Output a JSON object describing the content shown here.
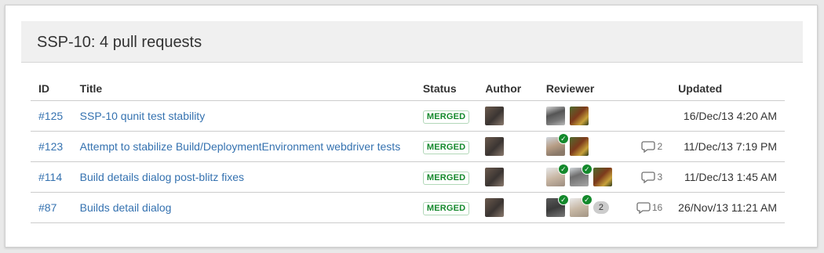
{
  "dialog": {
    "title": "SSP-10: 4 pull requests"
  },
  "table": {
    "headers": {
      "id": "ID",
      "title": "Title",
      "status": "Status",
      "author": "Author",
      "reviewer": "Reviewer",
      "updated": "Updated"
    },
    "rows": [
      {
        "id": "#125",
        "title": "SSP-10 qunit test stability",
        "status": "MERGED",
        "comments": "",
        "updated": "16/Dec/13 4:20 AM"
      },
      {
        "id": "#123",
        "title": "Attempt to stabilize Build/DeploymentEnvironment webdriver tests",
        "status": "MERGED",
        "comments": "2",
        "updated": "11/Dec/13 7:19 PM"
      },
      {
        "id": "#114",
        "title": "Build details dialog post-blitz fixes",
        "status": "MERGED",
        "comments": "3",
        "updated": "11/Dec/13 1:45 AM"
      },
      {
        "id": "#87",
        "title": "Builds detail dialog",
        "status": "MERGED",
        "comments": "16",
        "more_reviewers": "2",
        "updated": "26/Nov/13 11:21 AM"
      }
    ]
  },
  "colors": {
    "link": "#3572b0",
    "merged": "#14892c",
    "header_bg": "#f0f0f0"
  },
  "icons": {
    "approved": "check-icon",
    "comment": "comment-bubble-icon"
  }
}
